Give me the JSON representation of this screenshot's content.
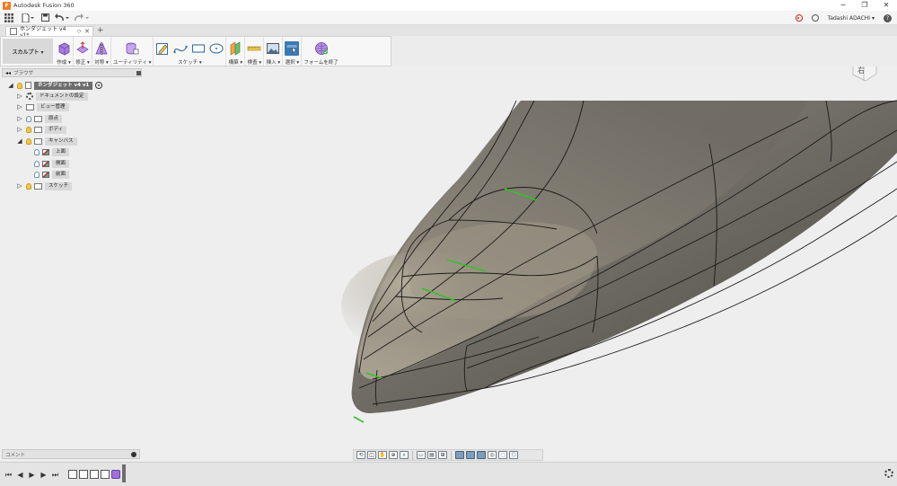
{
  "titlebar": {
    "app_title": "Autodesk Fusion 360",
    "minimize": "−",
    "restore": "❐",
    "close": "✕"
  },
  "qabar": {
    "user_name": "Tadashi ADACHI ▾",
    "help": "?"
  },
  "doc_tab": {
    "label": "ホンダジェット v4 v1*",
    "close": "✕",
    "add": "+"
  },
  "toolbar": {
    "workspace": "スカルプト ▾",
    "groups": [
      {
        "label": "作成 ▾"
      },
      {
        "label": "修正 ▾"
      },
      {
        "label": "対称 ▾"
      },
      {
        "label": "ユーティリティ ▾"
      },
      {
        "label": "スケッチ ▾"
      },
      {
        "label": "構築 ▾"
      },
      {
        "label": "検査 ▾"
      },
      {
        "label": "挿入 ▾"
      },
      {
        "label": "選択 ▾"
      },
      {
        "label": "フォームを終了"
      }
    ]
  },
  "browser": {
    "title": "ブラウザ",
    "nodes": [
      {
        "label": "ホンダジェット v4 v1"
      },
      {
        "label": "ドキュメントの設定"
      },
      {
        "label": "ビュー管理"
      },
      {
        "label": "原点"
      },
      {
        "label": "ボディ"
      },
      {
        "label": "キャンバス"
      },
      {
        "label": "上面"
      },
      {
        "label": "側面"
      },
      {
        "label": "前面"
      },
      {
        "label": "スケッチ"
      }
    ]
  },
  "comments": {
    "title": "コメント"
  },
  "viewcube": {
    "face": "右"
  },
  "colors": {
    "accent": "#3a7ab3",
    "edge_highlight": "#35c12a",
    "model_surface": "#6f6b63"
  }
}
